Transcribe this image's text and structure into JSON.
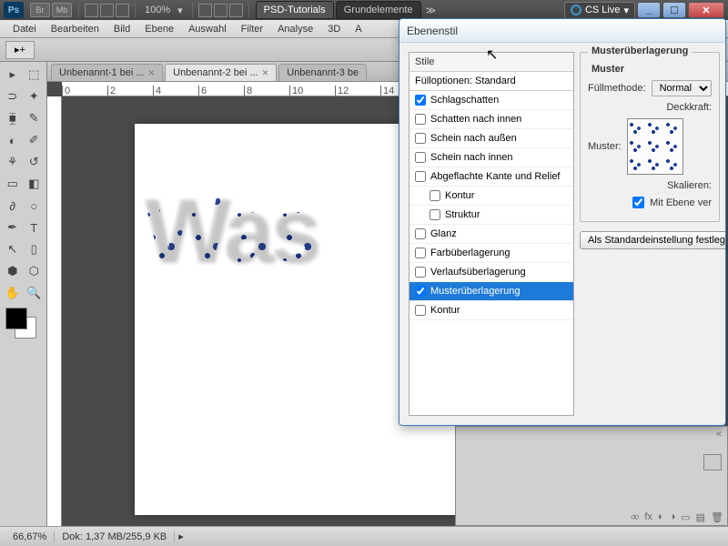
{
  "titlebar": {
    "ps": "Ps",
    "br": "Br",
    "mb": "Mb",
    "zoom": "100%",
    "tabs": {
      "active": "PSD-Tutorials",
      "inactive": "Grundelemente"
    },
    "cslive": "CS Live",
    "chev": "≫"
  },
  "menu": [
    "Datei",
    "Bearbeiten",
    "Bild",
    "Ebene",
    "Auswahl",
    "Filter",
    "Analyse",
    "3D",
    "A"
  ],
  "doc_tabs": [
    {
      "label": "Unbenannt-1 bei ...",
      "active": false
    },
    {
      "label": "Unbenannt-2 bei ...",
      "active": true
    },
    {
      "label": "Unbenannt-3 be",
      "active": false
    }
  ],
  "ruler_ticks": [
    "0",
    "2",
    "4",
    "6",
    "8",
    "10",
    "12",
    "14"
  ],
  "canvas_text": "Was",
  "statusbar": {
    "zoom": "66,67%",
    "docinfo": "Dok: 1,37 MB/255,9 KB"
  },
  "dialog": {
    "title": "Ebenenstil",
    "stile": "Stile",
    "fulloptions": "Fülloptionen: Standard",
    "items": [
      {
        "label": "Schlagschatten",
        "checked": true,
        "indent": false
      },
      {
        "label": "Schatten nach innen",
        "checked": false,
        "indent": false
      },
      {
        "label": "Schein nach außen",
        "checked": false,
        "indent": false
      },
      {
        "label": "Schein nach innen",
        "checked": false,
        "indent": false
      },
      {
        "label": "Abgeflachte Kante und Relief",
        "checked": false,
        "indent": false
      },
      {
        "label": "Kontur",
        "checked": false,
        "indent": true
      },
      {
        "label": "Struktur",
        "checked": false,
        "indent": true
      },
      {
        "label": "Glanz",
        "checked": false,
        "indent": false
      },
      {
        "label": "Farbüberlagerung",
        "checked": false,
        "indent": false
      },
      {
        "label": "Verlaufsüberlagerung",
        "checked": false,
        "indent": false
      },
      {
        "label": "Musterüberlagerung",
        "checked": true,
        "indent": false,
        "selected": true
      },
      {
        "label": "Kontur",
        "checked": false,
        "indent": false
      }
    ],
    "settings": {
      "group_title": "Musterüberlagerung",
      "sub_title": "Muster",
      "blend_label": "Füllmethode:",
      "blend_value": "Normal",
      "opacity_label": "Deckkraft:",
      "pattern_label": "Muster:",
      "scale_label": "Skalieren:",
      "link_label": "Mit Ebene ver",
      "default_btn": "Als Standardeinstellung festlegen"
    }
  }
}
